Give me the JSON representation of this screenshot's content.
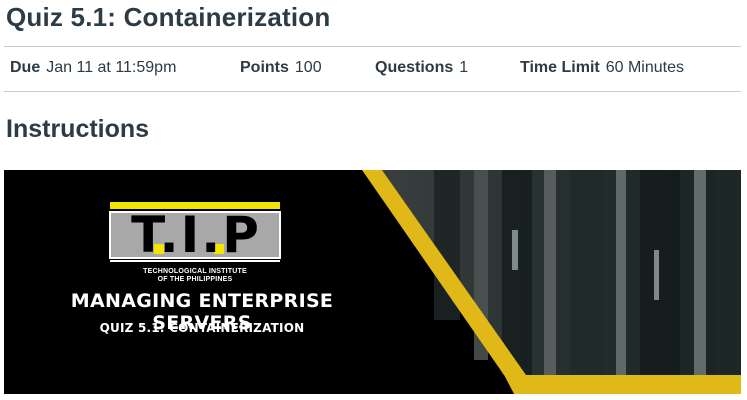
{
  "quiz": {
    "title": "Quiz 5.1: Containerization"
  },
  "meta": {
    "due_label": "Due",
    "due_value": "Jan 11 at 11:59pm",
    "points_label": "Points",
    "points_value": "100",
    "questions_label": "Questions",
    "questions_value": "1",
    "time_limit_label": "Time Limit",
    "time_limit_value": "60 Minutes"
  },
  "instructions": {
    "heading": "Instructions"
  },
  "banner": {
    "logo_letters": "T.I.P",
    "logo_caption_line1": "TECHNOLOGICAL INSTITUTE",
    "logo_caption_line2": "OF THE PHILIPPINES",
    "course_title": "MANAGING ENTERPRISE SERVERS",
    "quiz_subtitle": "QUIZ 5.1: CONTAINERIZATION",
    "accent_color": "#e0b818",
    "background_color": "#000000"
  }
}
